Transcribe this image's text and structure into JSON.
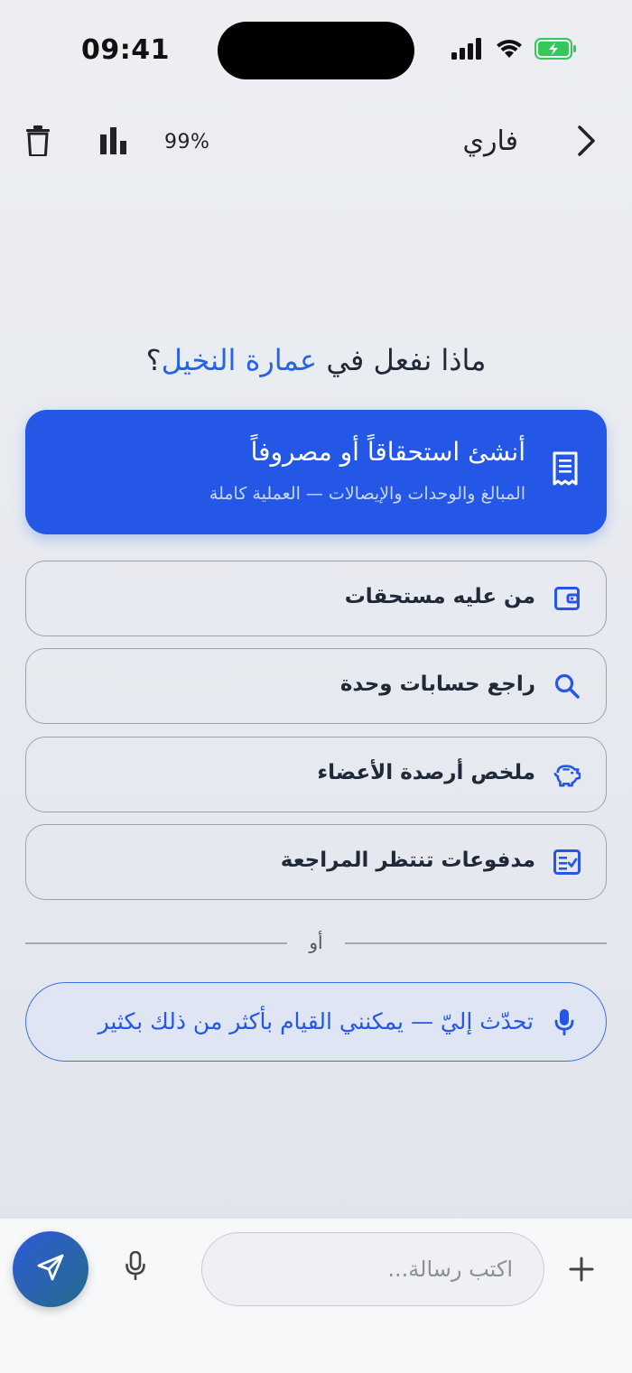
{
  "status_bar": {
    "time": "09:41"
  },
  "header": {
    "title": "فاري",
    "percent": "99%"
  },
  "main": {
    "heading_prefix": "ماذا نفعل في ",
    "heading_accent": "عمارة النخيل",
    "heading_suffix": "؟",
    "primary_card": {
      "title": "أنشئ استحقاقاً أو مصروفاً",
      "subtitle": "المبالغ والوحدات والإيصالات — العملية كاملة"
    },
    "options": [
      {
        "label": "من عليه مستحقات",
        "icon": "wallet-icon"
      },
      {
        "label": "راجع حسابات وحدة",
        "icon": "search-icon"
      },
      {
        "label": "ملخص أرصدة الأعضاء",
        "icon": "piggy-bank-icon"
      },
      {
        "label": "مدفوعات تنتظر المراجعة",
        "icon": "checklist-icon"
      }
    ],
    "divider_text": "أو",
    "voice_prompt": "تحدّث إليّ — يمكنني القيام بأكثر من ذلك بكثير"
  },
  "composer": {
    "placeholder": "اكتب رسالة...",
    "value": ""
  },
  "colors": {
    "accent": "#2457e6",
    "background": "#e6e9ef"
  }
}
